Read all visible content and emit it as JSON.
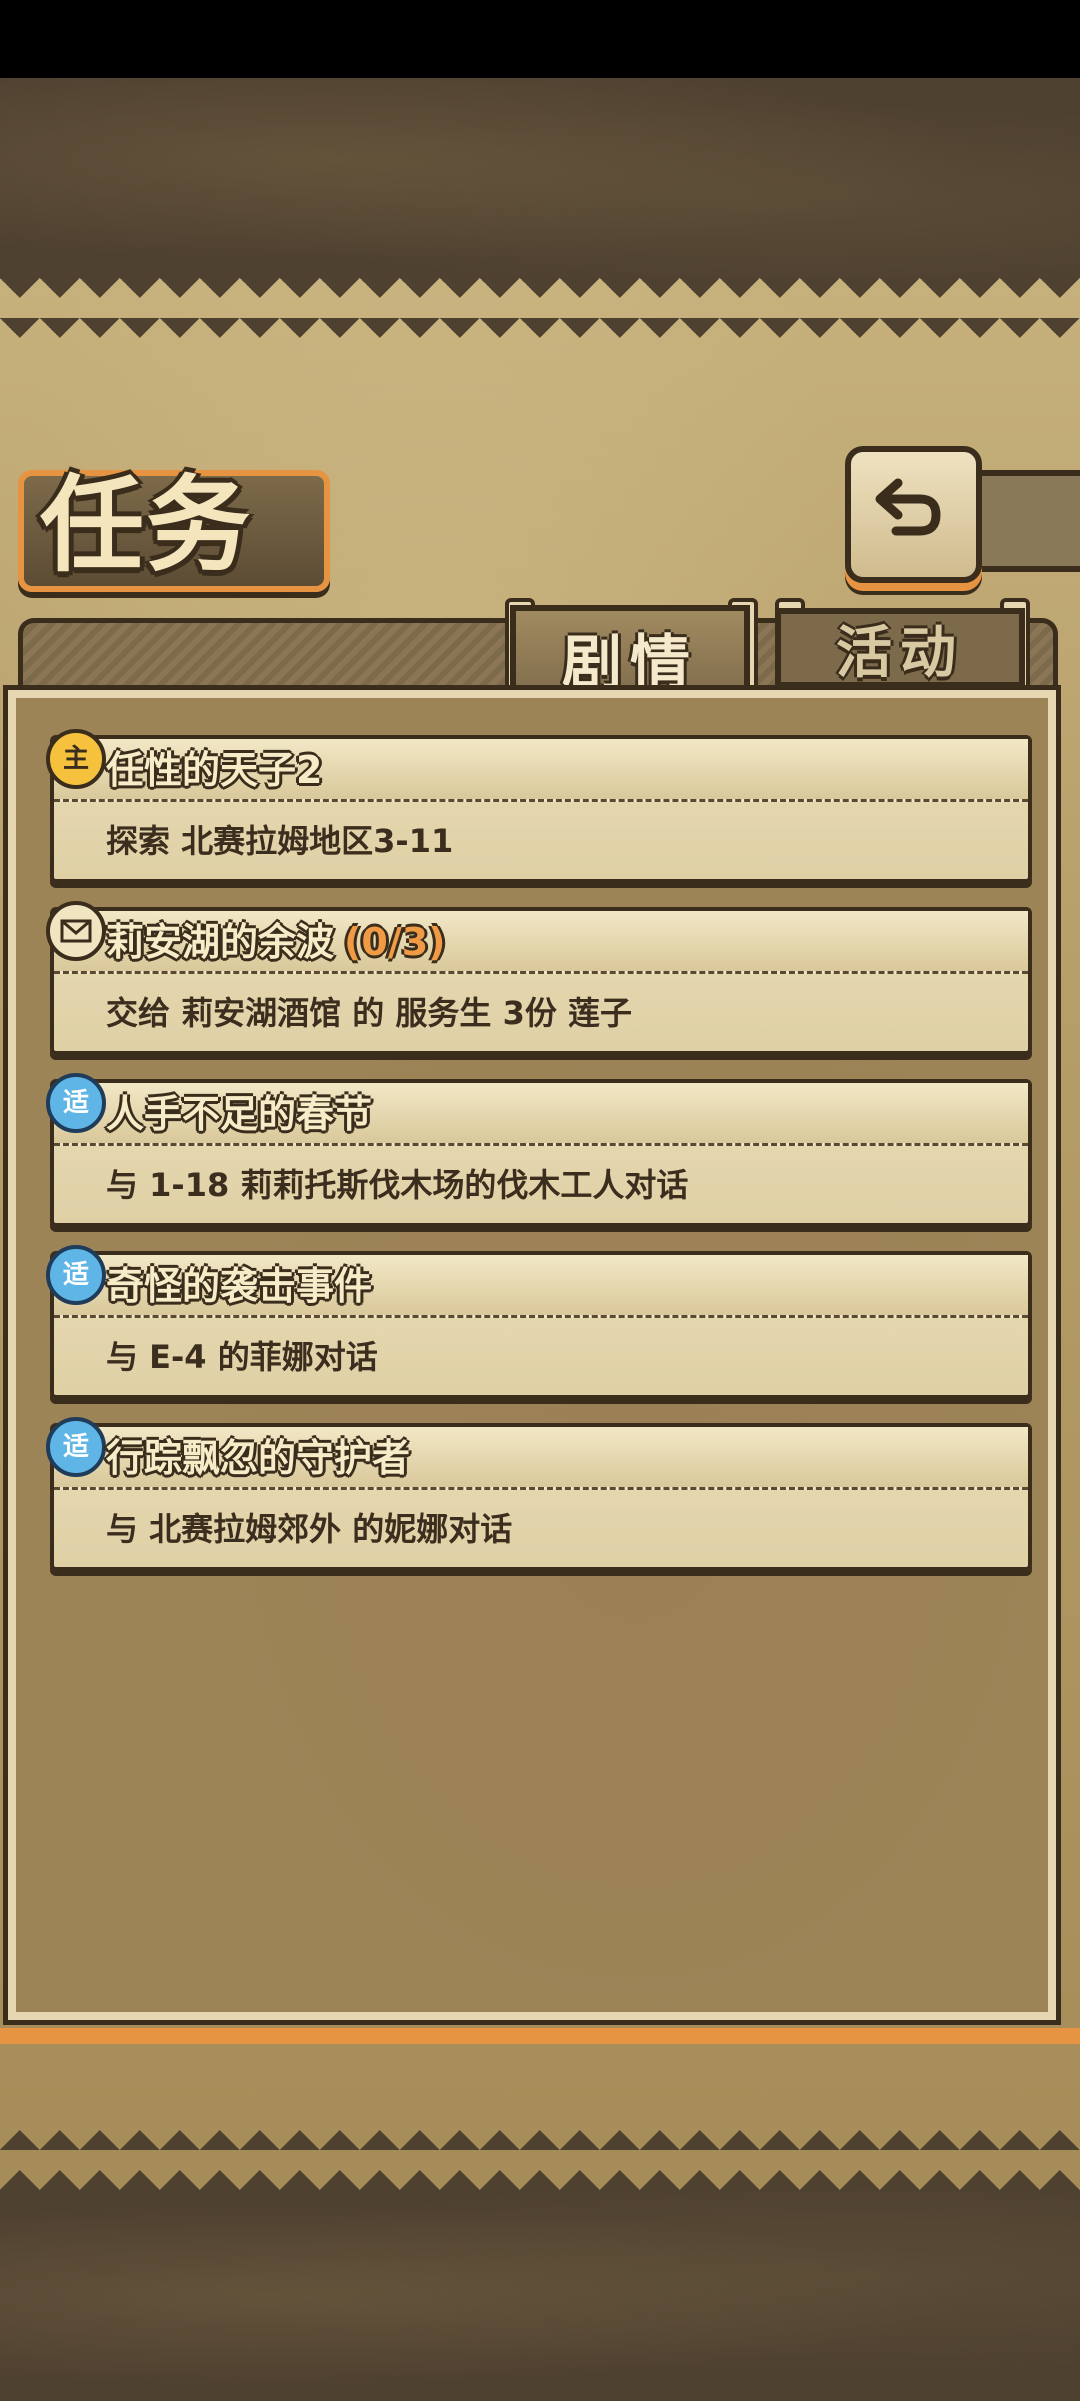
{
  "header": {
    "title": "任务"
  },
  "tabs": [
    {
      "label": "剧情",
      "active": true
    },
    {
      "label": "活动",
      "active": false
    }
  ],
  "quests": [
    {
      "icon": "main-quest-icon",
      "icon_char": "主",
      "title": "任性的天子2",
      "progress": "",
      "desc": "探索 北赛拉姆地区3-11"
    },
    {
      "icon": "mail-quest-icon",
      "icon_char": "",
      "title": "莉安湖的余波",
      "progress": "(0/3)",
      "desc": "交给 莉安湖酒馆 的 服务生 3份 莲子"
    },
    {
      "icon": "side-quest-icon",
      "icon_char": "适",
      "title": "人手不足的春节",
      "progress": "",
      "desc": "与 1-18 莉莉托斯伐木场的伐木工人对话"
    },
    {
      "icon": "side-quest-icon",
      "icon_char": "适",
      "title": "奇怪的袭击事件",
      "progress": "",
      "desc": "与 E-4 的菲娜对话"
    },
    {
      "icon": "side-quest-icon",
      "icon_char": "适",
      "title": "行踪飘忽的守护者",
      "progress": "",
      "desc": "与 北赛拉姆郊外 的妮娜对话"
    }
  ],
  "colors": {
    "accent_orange": "#e69342",
    "dark_outline": "#3a2d1c",
    "parchment": "#dfd0a6",
    "side_icon_blue": "#5fb6e6",
    "main_icon_gold": "#f6c23e"
  }
}
